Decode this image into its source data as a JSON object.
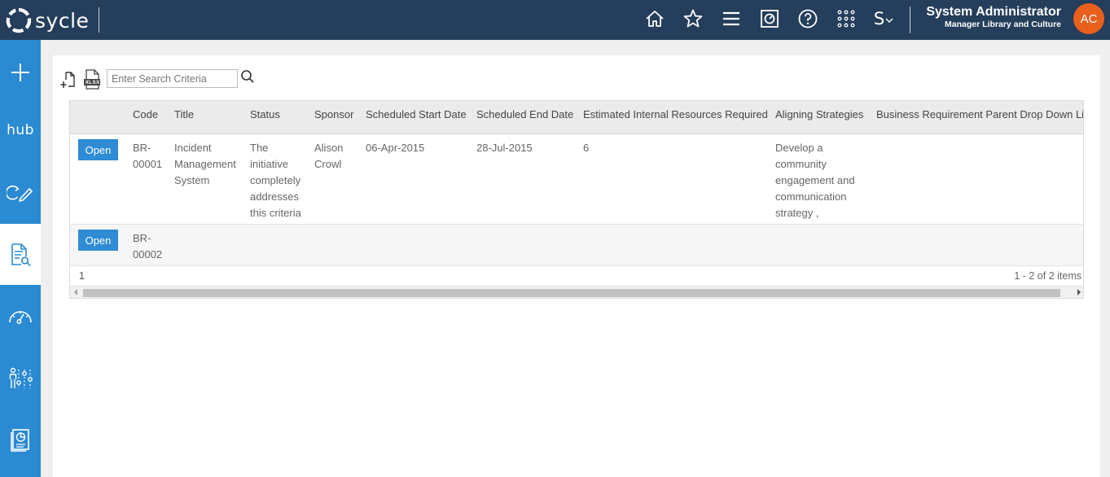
{
  "app": {
    "logo_text": "sycle",
    "user_name": "System Administrator",
    "user_role": "Manager Library and Culture",
    "avatar_initials": "AC",
    "nav_icons": [
      "home-icon",
      "star-icon",
      "menu-icon",
      "dashboard-icon",
      "help-icon",
      "apps-grid-icon",
      "language-switch-icon"
    ],
    "language_label": "S"
  },
  "sidebar": {
    "items": [
      {
        "icon": "plus-icon"
      },
      {
        "label": "hub"
      },
      {
        "icon": "refresh-edit-icon"
      },
      {
        "icon": "document-search-icon",
        "active": true
      },
      {
        "icon": "gauge-icon"
      },
      {
        "icon": "people-sliders-icon"
      },
      {
        "icon": "report-chart-icon"
      }
    ]
  },
  "toolbar": {
    "new_icon": "new-document-icon",
    "export_icon": "xlsx-export-icon",
    "export_label": "XLSX",
    "search_placeholder": "Enter Search Criteria",
    "search_icon": "search-icon"
  },
  "grid": {
    "columns": [
      "Code",
      "Title",
      "Status",
      "Sponsor",
      "Scheduled Start Date",
      "Scheduled End Date",
      "Estimated Internal Resources Required",
      "Aligning Strategies",
      "Business Requirement Parent Drop Down List"
    ],
    "open_label": "Open",
    "rows": [
      {
        "code": "BR-00001",
        "title": "Incident Management System",
        "status": "The initiative completely addresses this criteria",
        "sponsor": "Alison Crowl",
        "start": "06-Apr-2015",
        "end": "28-Jul-2015",
        "resources": "6",
        "strategies": "Develop a community engagement and communication strategy ,",
        "parent": ""
      },
      {
        "code": "BR-00002",
        "title": "",
        "status": "",
        "sponsor": "",
        "start": "",
        "end": "",
        "resources": "",
        "strategies": "",
        "parent": ""
      }
    ],
    "page_number": "1",
    "page_info": "1 - 2 of 2 items"
  },
  "colors": {
    "topbar": "#243e5b",
    "sidebar": "#2a8ad2",
    "button": "#2e8bd4",
    "avatar": "#e8601c"
  }
}
